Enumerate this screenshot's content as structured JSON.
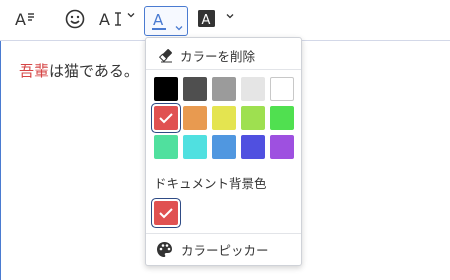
{
  "toolbar": {
    "buttons": [
      {
        "name": "font-style-icon"
      },
      {
        "name": "emoji-icon"
      },
      {
        "name": "text-size-icon"
      },
      {
        "name": "font-color-icon",
        "letter": "A",
        "underline_color": "#4a7bd1"
      },
      {
        "name": "highlight-color-icon",
        "letter": "A"
      }
    ]
  },
  "editor": {
    "text_red": "吾輩",
    "text_rest": "は猫である。",
    "red_color": "#d64545"
  },
  "color_menu": {
    "remove_color_label": "カラーを削除",
    "document_bg_label": "ドキュメント背景色",
    "color_picker_label": "カラーピッカー",
    "palette": [
      [
        "#000000",
        "#4f4f4f",
        "#9b9b9b",
        "#e5e5e5",
        "#ffffff"
      ],
      [
        "#e05151",
        "#e89a50",
        "#e4e450",
        "#9ee050",
        "#50e050"
      ],
      [
        "#50e09e",
        "#50e0e0",
        "#5097e0",
        "#5050e0",
        "#9e50e0"
      ]
    ],
    "selected_color": "#e05151",
    "document_bg_color": "#e05151"
  }
}
